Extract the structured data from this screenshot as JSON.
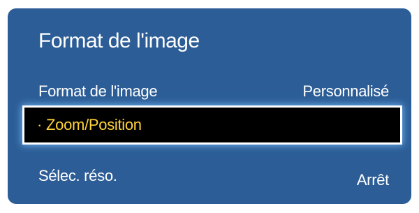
{
  "menu": {
    "title": "Format de l'image",
    "items": [
      {
        "label": "Format de l'image",
        "value": "Personnalisé"
      },
      {
        "bullet": "·",
        "label": "Zoom/Position",
        "value": ""
      },
      {
        "label": "Sélec. réso.",
        "value": "Arrêt"
      }
    ]
  },
  "colors": {
    "panel_background": "#2c5d96",
    "highlight_background": "#000000",
    "highlight_text": "#ffd23a",
    "text": "#ffffff"
  }
}
